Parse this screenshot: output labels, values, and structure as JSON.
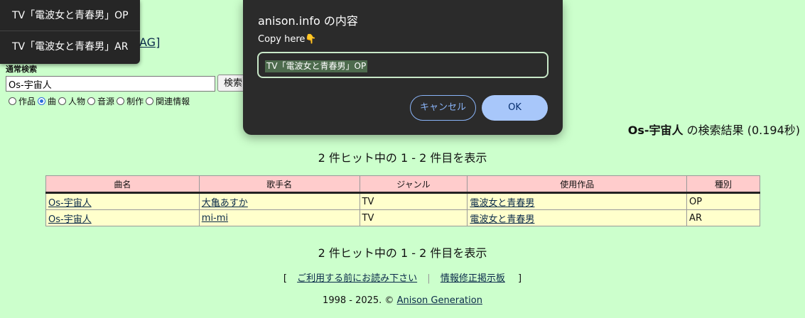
{
  "dropdown": {
    "items": [
      "TV「電波女と青春男」OP",
      "TV「電波女と青春男」AR"
    ]
  },
  "partial_link": "AG]",
  "search": {
    "label": "通常検索",
    "value": "Os-宇宙人",
    "button": "検索",
    "radios": [
      {
        "label": "作品",
        "checked": false
      },
      {
        "label": "曲",
        "checked": true
      },
      {
        "label": "人物",
        "checked": false
      },
      {
        "label": "音源",
        "checked": false
      },
      {
        "label": "制作",
        "checked": false
      },
      {
        "label": "関連情報",
        "checked": false
      }
    ]
  },
  "dialog": {
    "title": "anison.info の内容",
    "message": "Copy here👇",
    "input_value": "TV「電波女と青春男」OP",
    "cancel": "キャンセル",
    "ok": "OK"
  },
  "results": {
    "query": "Os-宇宙人",
    "suffix": "の検索結果 (0.194秒)",
    "hits_top": "2 件ヒット中の 1 - 2 件目を表示",
    "hits_bottom": "2 件ヒット中の 1 - 2 件目を表示",
    "headers": [
      "曲名",
      "歌手名",
      "ジャンル",
      "使用作品",
      "種別"
    ],
    "rows": [
      [
        "Os-宇宙人",
        "大亀あすか",
        "TV",
        "電波女と青春男",
        "OP"
      ],
      [
        "Os-宇宙人",
        "mi-mi",
        "TV",
        "電波女と青春男",
        "AR"
      ]
    ]
  },
  "footer": {
    "bracket_open": "[",
    "link1": "ご利用する前にお読み下さい",
    "separator": "|",
    "link2": "情報修正掲示板",
    "bracket_close": "]",
    "copyright_prefix": "1998 - 2025. ©",
    "copyright_link": "Anison Generation"
  }
}
